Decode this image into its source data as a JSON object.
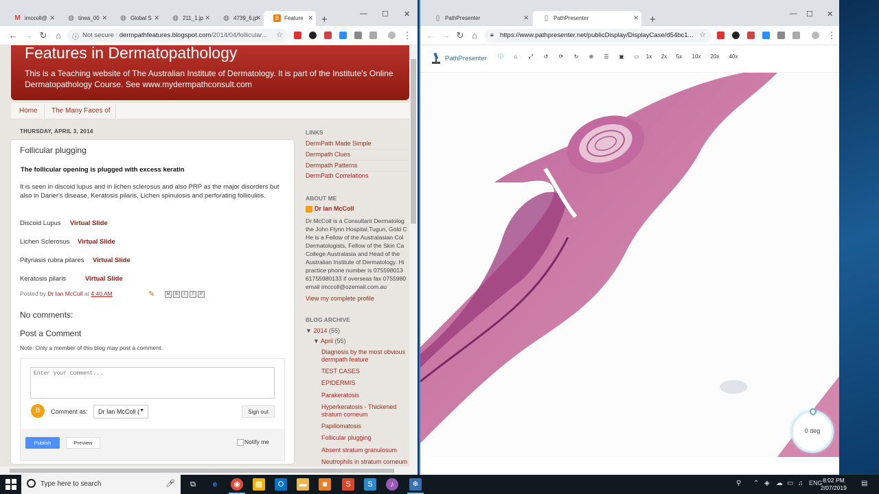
{
  "left_window": {
    "tabs": [
      {
        "label": "imccoll@",
        "icon": "gmail-icon",
        "color": "#d44638"
      },
      {
        "label": "tinea_00",
        "icon": "globe-icon",
        "color": "#666666"
      },
      {
        "label": "Global S",
        "icon": "globe-icon",
        "color": "#666666"
      },
      {
        "label": "211_1.jp",
        "icon": "globe-icon",
        "color": "#666666"
      },
      {
        "label": "4739_6.jp",
        "icon": "globe-icon",
        "color": "#666666"
      },
      {
        "label": "Feature",
        "icon": "blogger-icon",
        "color": "#f57d00"
      }
    ],
    "address": {
      "secure_label": "Not secure",
      "host": "dermpathfeatures.blogspot.com",
      "path": "/2014/04/follicular..."
    },
    "blog": {
      "title": "Features in Dermatopathology",
      "description": "This is a Teaching website of The Australian Institute of Dermatology. It is part of the Institute's Online Dermatopathology Course. See www.mydermpathconsult.com",
      "nav": [
        "Home",
        "The Many Faces of"
      ],
      "date": "THURSDAY, APRIL 3, 2014",
      "post": {
        "title": "Follicular plugging",
        "bold_line": "The follicular opening is plugged with excess keratin",
        "paragraph": "It is seen in discoid lupus and in lichen sclerosus and also PRP as the major disorders but also in Darier's disease, Keratosis pilaris, Lichen spinulosis and perforating folliculitis.",
        "slides": [
          {
            "name": "Discoid Lupus",
            "link": "Virtual Slide"
          },
          {
            "name": "Lichen Sclerosus",
            "link": "Virtual Slide"
          },
          {
            "name": "Pityriasis rubra pilares",
            "link": "Virtual Slide"
          },
          {
            "name": "Keratosis pilaris",
            "link": "Virtual Slide"
          }
        ],
        "posted_by_prefix": "Posted by",
        "author": "Dr Ian McColl",
        "at": "at",
        "time": "4:40 AM",
        "no_comments": "No comments:",
        "post_comment": "Post a Comment",
        "note": "Note: Only a member of this blog may post a comment.",
        "comment_placeholder": "Enter your comment...",
        "comment_as": "Comment as:",
        "comment_as_value": "Dr Ian McColl (",
        "sign_out": "Sign out",
        "publish": "Publish",
        "preview": "Preview",
        "notify": "Notify me"
      },
      "sidebar": {
        "links_heading": "LINKS",
        "links": [
          "DermPath Made Simple",
          "Dermpath Clues",
          "Dermpath Patterns",
          "DermPath Correlations"
        ],
        "about_heading": "ABOUT ME",
        "about_name": "Dr Ian McColl",
        "about_lines": [
          "Dr McColl is a Consultant Dermatolog",
          "the John Flynn Hospital,Tugun, Gold C",
          "He is a Fellow of the Australasian Col",
          "Dermatologists, Fellow of the Skin Ca",
          "College Australasia and Head of the",
          "Australian Institute of Dermatology. Hi",
          "practice phone number is 075598013",
          "61755980133 if overseas fax 0755980",
          "email imccoll@ozemail.com.au"
        ],
        "profile_link": "View my complete profile",
        "archive_heading": "BLOG ARCHIVE",
        "year": "2014",
        "year_count": "(55)",
        "month": "April",
        "month_count": "(55)",
        "posts": [
          "Diagnosis by the most obvious dermpath feature",
          "TEST CASES",
          "EPIDERMIS",
          "Parakeratosis",
          "Hyperkeratosis - Thickened stratum corneum",
          "Papillomatosis",
          "Follicular plugging",
          "Absent stratum granulosum",
          "Neutrophils in stratum corneum"
        ]
      }
    }
  },
  "right_window": {
    "tabs": [
      {
        "label": "PathPresenter"
      },
      {
        "label": "PathPresenter"
      }
    ],
    "address": {
      "url": "https://www.pathpresenter.net/publicDisplay/DisplayCase/d54bc1..."
    },
    "app_name": "PathPresenter",
    "zoom_levels": [
      "1x",
      "2x",
      "5x",
      "10x",
      "20x",
      "40x"
    ],
    "rotation": "0 deg"
  },
  "taskbar": {
    "search_placeholder": "Type here to search",
    "language": "ENG",
    "time": "8:02 PM",
    "date": "2/07/2019"
  },
  "colors": {
    "blog_red": "#a3271c",
    "accent_blue": "#4d90fe",
    "tissue_pink": "#d98aa8",
    "tissue_purple": "#8a3a7a"
  }
}
